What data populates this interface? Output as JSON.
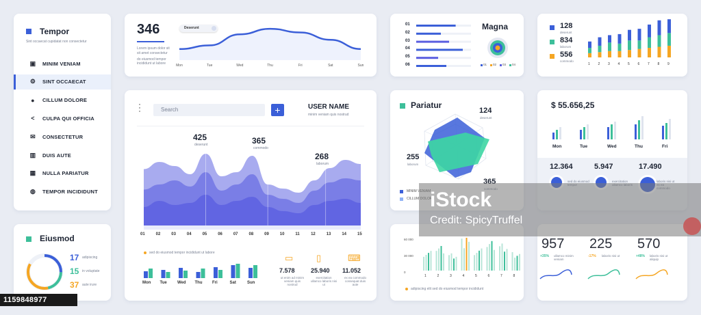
{
  "sidebar": {
    "title": "Tempor",
    "subtitle": "Sint occaecat cupidatat non consectetur",
    "accent": "#3b5fd8",
    "items": [
      {
        "label": "MINIM VENIAM",
        "icon": "briefcase-icon"
      },
      {
        "label": "SINT OCCAECAT",
        "icon": "gear-icon",
        "active": true
      },
      {
        "label": "CILLUM DOLORE",
        "icon": "info-icon"
      },
      {
        "label": "CULPA QUI OFFICIA",
        "icon": "share-icon"
      },
      {
        "label": "CONSECTETUR",
        "icon": "mail-icon"
      },
      {
        "label": "DUIS AUTE",
        "icon": "bar-chart-icon"
      },
      {
        "label": "NULLA PARIATUR",
        "icon": "calculator-icon"
      },
      {
        "label": "TEMPOR INCIDIDUNT",
        "icon": "globe-icon"
      }
    ]
  },
  "eiusmod": {
    "title": "Eiusmod",
    "stats": [
      {
        "value": "17",
        "label": "adipiscing",
        "color": "#3b5fd8"
      },
      {
        "value": "15",
        "label": "in voluptate",
        "color": "#3dbf9a"
      },
      {
        "value": "37",
        "label": "aute irure",
        "color": "#f5a623"
      }
    ]
  },
  "top_chart": {
    "value": "346",
    "caption1": "Lorem ipsum dolor sit",
    "caption2": "sit amet consectetur",
    "caption3": "do eiusmod tempor",
    "caption4": "incididunt ut labore",
    "toggle_label": "Deserunt",
    "chart_data": {
      "type": "line",
      "categories": [
        "Mon",
        "Tue",
        "Wed",
        "Thu",
        "Fri",
        "Sat",
        "Sun"
      ],
      "values": [
        6,
        8,
        14,
        17,
        15,
        11,
        6
      ],
      "ylim": [
        0,
        20
      ]
    }
  },
  "main": {
    "search_placeholder": "Search",
    "add_label": "+",
    "user_name": "USER NAME",
    "user_sub": "minim veniam quis nostrud",
    "annotations": [
      {
        "value": "425",
        "label": "deserunt"
      },
      {
        "value": "365",
        "label": "commodo"
      },
      {
        "value": "268",
        "label": "laborum"
      }
    ],
    "chart_data": {
      "type": "area",
      "x": [
        "01",
        "02",
        "03",
        "04",
        "05",
        "06",
        "07",
        "08",
        "09",
        "10",
        "11",
        "12",
        "13",
        "14",
        "15"
      ],
      "series": [
        {
          "values": [
            55,
            62,
            58,
            50,
            70,
            48,
            52,
            68,
            40,
            36,
            32,
            44,
            56,
            64,
            60
          ]
        },
        {
          "values": [
            35,
            40,
            44,
            38,
            52,
            34,
            40,
            50,
            30,
            26,
            22,
            34,
            42,
            46,
            44
          ]
        },
        {
          "values": [
            18,
            24,
            20,
            22,
            30,
            20,
            24,
            28,
            18,
            14,
            12,
            20,
            24,
            26,
            22
          ]
        }
      ]
    },
    "legend": "sed do eiusmod tempor incididunt ut labore",
    "bar_chart": {
      "type": "bar",
      "categories": [
        "Mon",
        "Tue",
        "Wed",
        "Thu",
        "Fri",
        "Sat",
        "Sun"
      ],
      "series": [
        {
          "values": [
            10,
            12,
            15,
            9,
            16,
            19,
            15
          ]
        },
        {
          "values": [
            14,
            9,
            11,
            14,
            12,
            21,
            19
          ]
        }
      ]
    },
    "devices": [
      {
        "icon": "monitor-icon",
        "value": "7.578",
        "caption": "ut enim ad minim veniam quis nostrud"
      },
      {
        "icon": "phone-icon",
        "value": "25.940",
        "caption": "exercitation ullamco laboris nisi ut"
      },
      {
        "icon": "laptop-icon",
        "value": "11.052",
        "caption": "ex ea commodo consequat duis aute"
      }
    ]
  },
  "magna": {
    "title": "Magna",
    "rows": [
      "01",
      "02",
      "03",
      "04",
      "05",
      "06"
    ],
    "bars": [
      0.72,
      0.45,
      0.6,
      0.85,
      0.4,
      0.55
    ],
    "legend": [
      "01",
      "02",
      "03",
      "04"
    ]
  },
  "stack": {
    "stats": [
      {
        "value": "128",
        "label": "deserunt",
        "color": "#3b5fd8"
      },
      {
        "value": "834",
        "label": "laborum",
        "color": "#3dbf9a"
      },
      {
        "value": "556",
        "label": "commodo",
        "color": "#f5a623"
      }
    ],
    "chart_data": {
      "type": "bar",
      "categories": [
        "1",
        "2",
        "3",
        "4",
        "5",
        "6",
        "7",
        "8",
        "9"
      ],
      "series": [
        {
          "values": [
            6,
            8,
            7,
            9,
            10,
            11,
            12,
            14,
            13
          ]
        },
        {
          "values": [
            5,
            6,
            8,
            7,
            9,
            8,
            10,
            11,
            12
          ]
        },
        {
          "values": [
            4,
            5,
            6,
            6,
            7,
            8,
            9,
            10,
            11
          ]
        }
      ]
    }
  },
  "pariatur": {
    "title": "Pariatur",
    "values": [
      {
        "value": "124",
        "label": "deserunt"
      },
      {
        "value": "255",
        "label": "laborum"
      },
      {
        "value": "365",
        "label": "commodo"
      }
    ],
    "legend": [
      "MINIM VENIAM",
      "CILLUM DOLORE"
    ]
  },
  "money": {
    "value": "$ 55.656,25",
    "days": [
      "Mon",
      "Tue",
      "Wed",
      "Thu",
      "Fri"
    ],
    "stats": [
      {
        "value": "12.364",
        "label": "sed do eiusmod tempor"
      },
      {
        "value": "5.947",
        "label": "exercitation ullamco laboris"
      },
      {
        "value": "17.490",
        "label": "laboris nisi ut ex ea commodo"
      }
    ]
  },
  "bottom_mid": {
    "chart_data": {
      "type": "bar",
      "categories": [
        "1",
        "2",
        "3",
        "4",
        "5",
        "6",
        "7",
        "8"
      ],
      "yticks": [
        "60 000",
        "30 000",
        "0"
      ],
      "values": [
        32,
        40,
        28,
        52,
        36,
        48,
        44,
        30
      ]
    },
    "legend": "adipiscing elit sed do eiusmod tempor incididunt"
  },
  "kpis": [
    {
      "value": "957",
      "delta": "+35%",
      "delta_color": "#3dbf9a",
      "caption": "ullamco minim veniam"
    },
    {
      "value": "225",
      "delta": "-17%",
      "delta_color": "#f5a623",
      "caption": "laboris nisi ut"
    },
    {
      "value": "570",
      "delta": "+48%",
      "delta_color": "#3dbf9a",
      "caption": "laboris nisi ut aliquip"
    }
  ],
  "watermark": {
    "brand": "iStock",
    "credit": "Credit: SpicyTruffel"
  },
  "stock_id": "1159848977"
}
